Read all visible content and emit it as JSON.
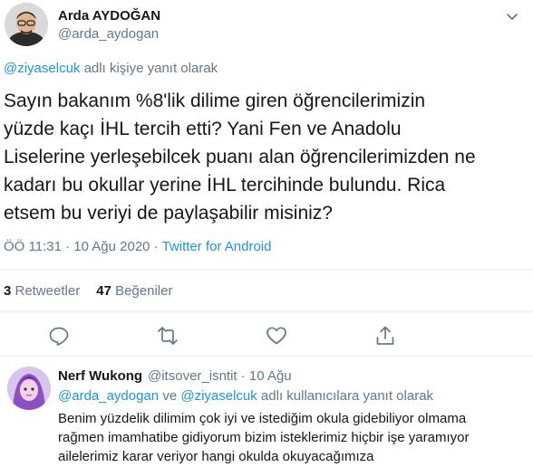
{
  "tweet": {
    "author_name": "Arda AYDOĞAN",
    "author_handle": "@arda_aydogan",
    "reply_prefix_link": "@ziyaselcuk",
    "reply_suffix": " adlı kişiye yanıt olarak",
    "text": "Sayın bakanım %8'lik dilime giren öğrencilerimizin\nyüzde kaçı İHL tercih etti? Yani Fen ve Anadolu\nLiselerine yerleşebilcek puanı alan öğrencilerimizden ne\nkadarı bu okullar yerine İHL tercihinde bulundu. Rica\netsem bu veriyi de paylaşabilir misiniz?",
    "timestamp": "ÖÖ 11:31 · 10 Ağu 2020 · ",
    "source": "Twitter for Android",
    "retweets_count": "3",
    "retweets_label": " Retweetler",
    "likes_count": "47",
    "likes_label": " Beğeniler"
  },
  "actions": {
    "reply_icon": "reply-icon",
    "retweet_icon": "retweet-icon",
    "like_icon": "heart-icon",
    "share_icon": "share-icon"
  },
  "reply": {
    "author_name": "Nerf Wukong",
    "author_handle": "@itsover_isntit · 10 Ağu",
    "reply_link1": "@arda_aydogan",
    "reply_and": " ve ",
    "reply_link2": "@ziyaselcuk",
    "reply_suffix": " adlı kullanıcılara yanıt olarak",
    "text": "Benim yüzdelik dilimim çok iyi ve istediğim okula gidebiliyor olmama\nrağmen imamhatibe gidiyorum bizim isteklerimiz hiçbir işe yaramıyor\nailelerimiz karar veriyor hangi okulda okuyacağımıza"
  },
  "colors": {
    "link": "#1b95e0",
    "secondary_text": "#657786",
    "primary_text": "#14171a",
    "divider": "#e6ecf0"
  }
}
